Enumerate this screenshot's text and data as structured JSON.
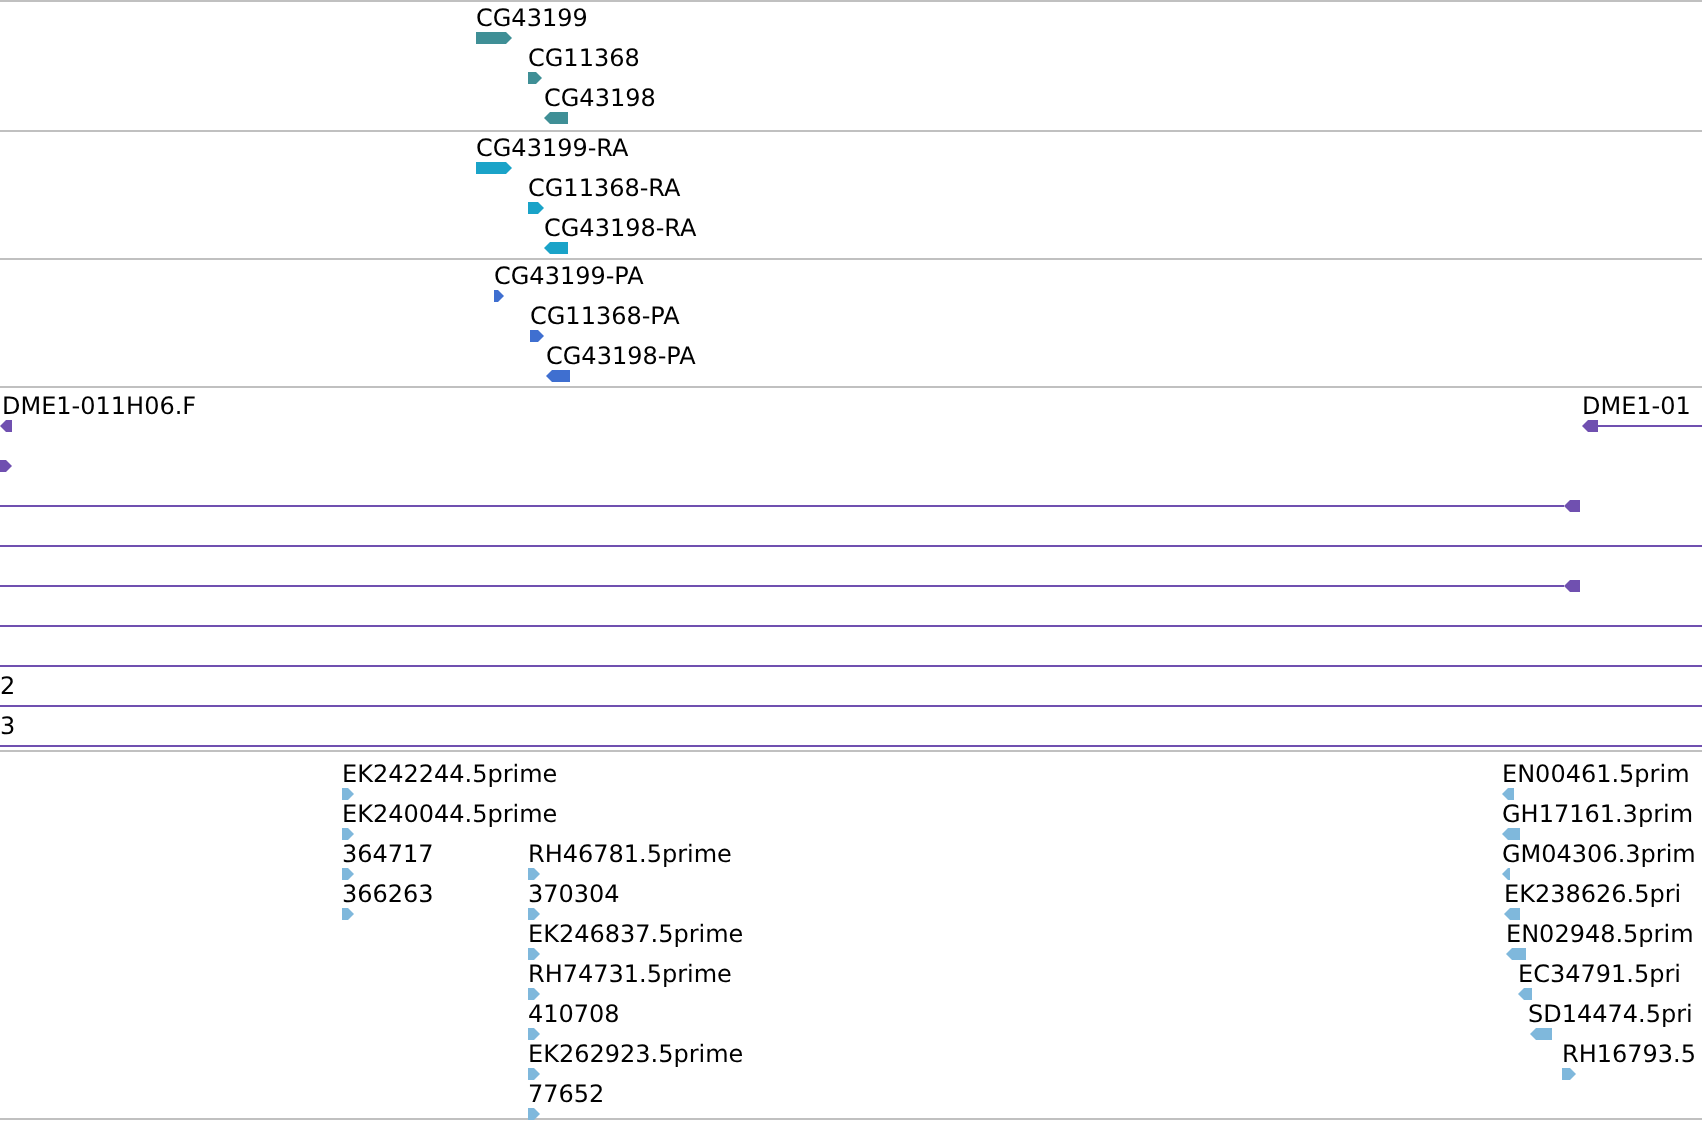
{
  "tracks": [
    {
      "color": "#3f8f96",
      "features": [
        {
          "label": "CG43199",
          "reverse": false,
          "kind": "glyph"
        },
        {
          "label": "CG11368",
          "reverse": false,
          "kind": "glyph"
        },
        {
          "label": "CG43198",
          "reverse": true,
          "kind": "glyph"
        }
      ]
    },
    {
      "color": "#1aa3c8",
      "features": [
        {
          "label": "CG43199-RA",
          "reverse": false,
          "kind": "glyph"
        },
        {
          "label": "CG11368-RA",
          "reverse": false,
          "kind": "glyph"
        },
        {
          "label": "CG43198-RA",
          "reverse": true,
          "kind": "glyph"
        }
      ]
    },
    {
      "color": "#3f6fd0",
      "features": [
        {
          "label": "CG43199-PA",
          "reverse": false,
          "kind": "glyph"
        },
        {
          "label": "CG11368-PA",
          "reverse": false,
          "kind": "glyph"
        },
        {
          "label": "CG43198-PA",
          "reverse": true,
          "kind": "glyph"
        }
      ]
    },
    {
      "color": "#7050b0",
      "features": [
        {
          "label": "DME1-011H06.F",
          "reverse": true,
          "kind": "glyph"
        },
        {
          "label": "DME1-01",
          "reverse": true,
          "kind": "span-start"
        },
        {
          "reverse": false,
          "kind": "glyph"
        },
        {
          "reverse": true,
          "kind": "span-end"
        },
        {
          "kind": "span"
        },
        {
          "reverse": true,
          "kind": "span-end"
        },
        {
          "kind": "span"
        },
        {
          "kind": "span"
        },
        {
          "label": "2",
          "kind": "span"
        },
        {
          "label": "3",
          "kind": "span"
        }
      ]
    },
    {
      "color": "#7fb8dc",
      "features": [
        {
          "label": "EK242244.5prime",
          "reverse": false,
          "kind": "glyph"
        },
        {
          "label": "EK240044.5prime",
          "reverse": false,
          "kind": "glyph"
        },
        {
          "label": "364717",
          "reverse": false,
          "kind": "glyph"
        },
        {
          "label": "366263",
          "reverse": false,
          "kind": "glyph"
        },
        {
          "label": "RH46781.5prime",
          "reverse": false,
          "kind": "glyph"
        },
        {
          "label": "370304",
          "reverse": false,
          "kind": "glyph"
        },
        {
          "label": "EK246837.5prime",
          "reverse": false,
          "kind": "glyph"
        },
        {
          "label": "RH74731.5prime",
          "reverse": false,
          "kind": "glyph"
        },
        {
          "label": "410708",
          "reverse": false,
          "kind": "glyph"
        },
        {
          "label": "EK262923.5prime",
          "reverse": false,
          "kind": "glyph"
        },
        {
          "label": "77652",
          "reverse": false,
          "kind": "glyph"
        },
        {
          "label": "EN00461.5prim",
          "reverse": true,
          "kind": "glyph"
        },
        {
          "label": "GH17161.3prim",
          "reverse": true,
          "kind": "glyph"
        },
        {
          "label": "GM04306.3prim",
          "reverse": true,
          "kind": "glyph"
        },
        {
          "label": "EK238626.5pri",
          "reverse": true,
          "kind": "glyph"
        },
        {
          "label": "EN02948.5prim",
          "reverse": true,
          "kind": "glyph"
        },
        {
          "label": "EC34791.5pri",
          "reverse": true,
          "kind": "glyph"
        },
        {
          "label": "SD14474.5pri",
          "reverse": true,
          "kind": "glyph"
        },
        {
          "label": "RH16793.5",
          "reverse": false,
          "kind": "glyph"
        }
      ]
    }
  ]
}
